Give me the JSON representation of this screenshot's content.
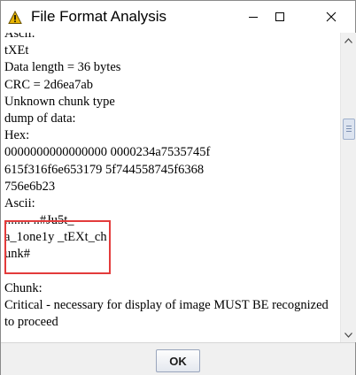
{
  "window": {
    "title": "File Format Analysis",
    "app_icon": "warning-icon",
    "controls": [
      "minimize-icon",
      "maximize-icon",
      "close-icon"
    ]
  },
  "content_lines": [
    "Ascii:",
    "tXEt",
    "Data length = 36 bytes",
    "CRC = 2d6ea7ab",
    "Unknown chunk type",
    "dump of data:",
    "Hex:",
    "0000000000000000 0000234a7535745f",
    "615f316f6e653179 5f744558745f6368",
    "756e6b23",
    "Ascii:",
    "........ ..#Ju5t_",
    "a_1one1y _tEXt_ch",
    "unk#",
    "",
    "Chunk:",
    "Critical - necessary for display of image MUST BE recognized to proceed"
  ],
  "buttons": {
    "ok_label": "OK"
  },
  "colors": {
    "highlight_border": "#e33b3b",
    "warning_icon": "#e8b400"
  }
}
